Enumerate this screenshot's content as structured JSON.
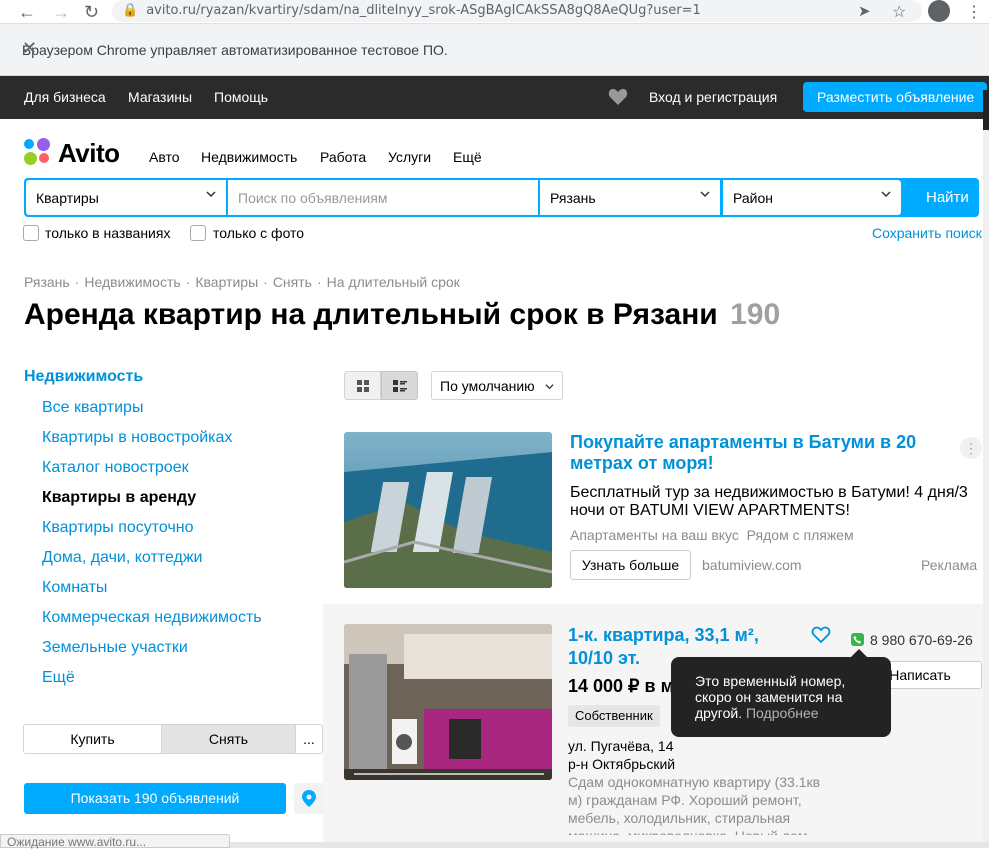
{
  "browser": {
    "url": "avito.ru/ryazan/kvartiry/sdam/na_dlitelnyy_srok-ASgBAgICAkSSA8gQ8AeQUg?user=1",
    "infobar_text": "Браузером Chrome управляет автоматизированное тестовое ПО.",
    "status_text": "Ожидание www.avito.ru..."
  },
  "topnav": {
    "business": "Для бизнеса",
    "shops": "Магазины",
    "help": "Помощь",
    "login": "Вход и регистрация",
    "post_ad": "Разместить объявление"
  },
  "logo_text": "Avito",
  "categories": [
    "Авто",
    "Недвижимость",
    "Работа",
    "Услуги",
    "Ещё"
  ],
  "search": {
    "category": "Квартиры",
    "placeholder": "Поиск по объявлениям",
    "city": "Рязань",
    "district": "Район",
    "submit": "Найти",
    "only_titles": "только в названиях",
    "only_photo": "только с фото",
    "save_search": "Сохранить поиск"
  },
  "breadcrumbs": [
    "Рязань",
    "Недвижимость",
    "Квартиры",
    "Снять",
    "На длительный срок"
  ],
  "page": {
    "title": "Аренда квартир на длительный срок в Рязани",
    "count": "190"
  },
  "sidebar": {
    "title": "Недвижимость",
    "items": [
      "Все квартиры",
      "Квартиры в новостройках",
      "Каталог новостроек",
      "Квартиры в аренду",
      "Квартиры посуточно",
      "Дома, дачи, коттеджи",
      "Комнаты",
      "Коммерческая недвижимость",
      "Земельные участки",
      "Ещё"
    ],
    "active_index": 3,
    "deal_tabs": [
      "Купить",
      "Снять",
      "..."
    ],
    "show_button": "Показать 190 объявлений"
  },
  "sort": {
    "selected": "По умолчанию"
  },
  "ad": {
    "title": "Покупайте апартаменты в Батуми в 20 метрах от моря!",
    "description": "Бесплатный тур за недвижимостью в Батуми! 4 дня/3 ночи от BATUMI VIEW APARTMENTS!",
    "tags": "Апартаменты на ваш вкус  Рядом с пляжем",
    "button": "Узнать больше",
    "domain": "batumiview.com",
    "label": "Реклама"
  },
  "listing": {
    "title": "1-к. квартира, 33,1 м², 10/10 эт.",
    "price": "14 000 ₽ в м",
    "badge": "Собственник",
    "address": "ул. Пугачёва, 14",
    "district": "р-н Октябрьский",
    "description": "Сдам однокомнатную квартиру (33.1кв м) гражданам РФ. Хороший ремонт, мебель, холодильник, стиральная машина, микроволновка. Новый дом",
    "phone": "8 980 670-69-26",
    "write": "Написать"
  },
  "tooltip": {
    "text": "Это временный номер, скоро он заменится на другой.",
    "more": "Подробнее"
  }
}
